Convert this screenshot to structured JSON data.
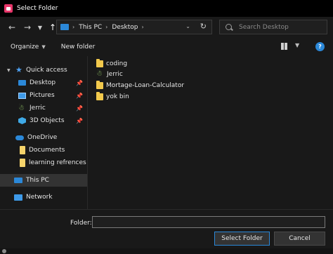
{
  "window": {
    "title": "Select Folder",
    "accent": "#2b88d8"
  },
  "nav": {
    "back_icon": "arrow-left-icon",
    "forward_icon": "arrow-right-icon",
    "recent_icon": "chevron-down-icon",
    "up_icon": "arrow-up-icon",
    "breadcrumb": [
      "This PC",
      "Desktop"
    ],
    "refresh_icon": "refresh-icon",
    "search_placeholder": "Search Desktop"
  },
  "commands": {
    "organize": "Organize",
    "new_folder": "New folder",
    "help": "?"
  },
  "sidebar": {
    "items": [
      {
        "label": "Quick access",
        "icon": "star-icon"
      },
      {
        "label": "Desktop",
        "icon": "desktop-icon",
        "pinned": true
      },
      {
        "label": "Pictures",
        "icon": "pictures-icon",
        "pinned": true
      },
      {
        "label": "Jerric",
        "icon": "user-folder-icon",
        "pinned": true
      },
      {
        "label": "3D Objects",
        "icon": "3d-objects-icon",
        "pinned": true
      },
      {
        "label": "OneDrive",
        "icon": "cloud-icon"
      },
      {
        "label": "Documents",
        "icon": "folder-icon"
      },
      {
        "label": "learning refrences",
        "icon": "folder-icon"
      },
      {
        "label": "This PC",
        "icon": "pc-icon",
        "selected": true
      },
      {
        "label": "Network",
        "icon": "network-icon"
      }
    ]
  },
  "files": [
    {
      "name": "coding",
      "icon": "folder-icon"
    },
    {
      "name": "Jerric",
      "icon": "user-folder-icon"
    },
    {
      "name": "Mortage-Loan-Calculator",
      "icon": "folder-icon"
    },
    {
      "name": "yok bin",
      "icon": "folder-icon"
    }
  ],
  "footer": {
    "folder_label": "Folder:",
    "folder_value": "",
    "select_button": "Select Folder",
    "cancel_button": "Cancel"
  }
}
